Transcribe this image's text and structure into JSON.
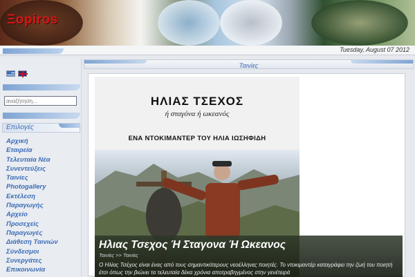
{
  "header": {
    "site_name": "Ξopiros"
  },
  "date_bar": {
    "date": "Tuesday, August 07 2012"
  },
  "languages": [
    {
      "name": "greek-flag-icon"
    },
    {
      "name": "english-flag-icon"
    }
  ],
  "search": {
    "placeholder": "αναζήτηση..."
  },
  "menu": {
    "title": "Επιλογές",
    "items": [
      "Αρχική",
      "Εταιρεία",
      "Τελευταία Νέα",
      "Συνεντεύξεις",
      "Ταινίες",
      "Photogallery",
      "Εκτέλεση",
      "Παραγωγής",
      "Αρχείο",
      "Προσεχείς",
      "Παραγωγές",
      "Διάθεση Ταινιών",
      "Σύνδεσμοι",
      "Συνεργάτες",
      "Επικοινωνία"
    ]
  },
  "main": {
    "section_title": "Ταινίες",
    "poster": {
      "title": "ΗΛΙΑΣ ΤΣΕΧΟΣ",
      "subtitle": "ή σταγόνα ή ωκεανός",
      "credit": "ΕΝΑ ΝΤΟΚΙΜΑΝΤΕΡ ΤΟΥ ΗΛΙΑ ΙΩΣΗΦΙΔΗ"
    },
    "caption": {
      "title": "Ηλιας Τσεχος Ή Σταγονα Ή Ωκεανος",
      "breadcrumb": "Ταινίες >> Ταινίες",
      "text": "Ο Ηλίας Τσέχος είναι ένας από τους σημαντικότερους νεοέλληνες ποιητές. Το ντοκιμαντέρ καταγράφει την ζωή του ποιητή έτσι όπως την βιώνει τα τελευταία δέκα χρόνια αποτραβηγμένος στην γενέτειρά"
    }
  },
  "colors": {
    "accent": "#3f6fb3",
    "logo": "#d21818"
  }
}
